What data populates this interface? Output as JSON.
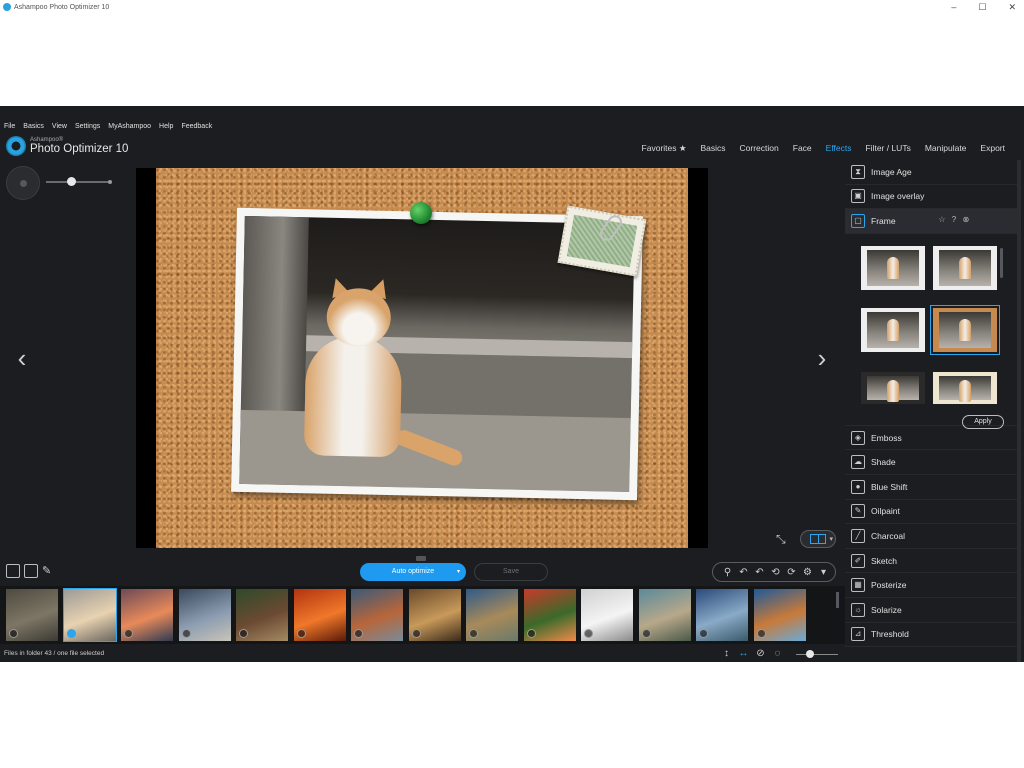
{
  "window": {
    "title": "Ashampoo Photo Optimizer 10",
    "controls": [
      "–",
      "☐",
      "✕"
    ]
  },
  "menu": [
    "File",
    "Basics",
    "View",
    "Settings",
    "MyAshampoo",
    "Help",
    "Feedback"
  ],
  "brand": {
    "company": "Ashampoo®",
    "product": "Photo Optimizer 10"
  },
  "tabs": [
    {
      "label": "Favorites ★",
      "active": false
    },
    {
      "label": "Basics",
      "active": false
    },
    {
      "label": "Correction",
      "active": false
    },
    {
      "label": "Face",
      "active": false
    },
    {
      "label": "Effects",
      "active": true
    },
    {
      "label": "Filter / LUTs",
      "active": false
    },
    {
      "label": "Manipulate",
      "active": false
    },
    {
      "label": "Export",
      "active": false
    }
  ],
  "nav": {
    "prev": "‹",
    "next": "›"
  },
  "effects_top": [
    {
      "label": "Image Age",
      "icon": "hourglass-icon",
      "glyph": "⧗"
    },
    {
      "label": "Image overlay",
      "icon": "image-overlay-icon",
      "glyph": "▣"
    },
    {
      "label": "Frame",
      "icon": "frame-icon",
      "glyph": "▢",
      "active": true
    }
  ],
  "frame_tools": [
    "☆",
    "?",
    "⊗"
  ],
  "apply_label": "Apply",
  "effects_bottom": [
    {
      "label": "Emboss",
      "icon": "emboss-icon",
      "glyph": "◈"
    },
    {
      "label": "Shade",
      "icon": "shade-icon",
      "glyph": "☁"
    },
    {
      "label": "Blue Shift",
      "icon": "blue-shift-icon",
      "glyph": "●"
    },
    {
      "label": "Oilpaint",
      "icon": "oilpaint-icon",
      "glyph": "✎"
    },
    {
      "label": "Charcoal",
      "icon": "charcoal-icon",
      "glyph": "╱"
    },
    {
      "label": "Sketch",
      "icon": "sketch-icon",
      "glyph": "✐"
    },
    {
      "label": "Posterize",
      "icon": "posterize-icon",
      "glyph": "▦"
    },
    {
      "label": "Solarize",
      "icon": "solarize-icon",
      "glyph": "☼"
    },
    {
      "label": "Threshold",
      "icon": "threshold-icon",
      "glyph": "⊿"
    }
  ],
  "actions": {
    "auto_optimize": "Auto optimize",
    "save": "Save"
  },
  "history_tools": [
    "⚲",
    "↶",
    "↶",
    "⟲",
    "⟳",
    "⚙",
    "▾"
  ],
  "filmstrip": [
    {
      "colors": [
        "#4e4a40",
        "#7d7665",
        "#3c3a34"
      ],
      "selected": false
    },
    {
      "colors": [
        "#9c9a96",
        "#e8d2b0",
        "#6a6660"
      ],
      "selected": true
    },
    {
      "colors": [
        "#6c4a58",
        "#e88a5a",
        "#2e3a52"
      ],
      "selected": false
    },
    {
      "colors": [
        "#3a4a5c",
        "#8a9bb0",
        "#c8c4b8"
      ],
      "selected": false
    },
    {
      "colors": [
        "#2f4a2a",
        "#6b4a32",
        "#a58a62"
      ],
      "selected": false
    },
    {
      "colors": [
        "#b23410",
        "#f0782a",
        "#5a1a08"
      ],
      "selected": false
    },
    {
      "colors": [
        "#3a5a7a",
        "#b8663a",
        "#7a8a9a"
      ],
      "selected": false
    },
    {
      "colors": [
        "#6a4a2a",
        "#c89a5a",
        "#3a2a1a"
      ],
      "selected": false
    },
    {
      "colors": [
        "#2f5a8a",
        "#a88a5a",
        "#6a7a6a"
      ],
      "selected": false
    },
    {
      "colors": [
        "#c83a2a",
        "#3a6a2a",
        "#f08a4a"
      ],
      "selected": false
    },
    {
      "colors": [
        "#d0d0d0",
        "#f4f4f4",
        "#8a8a8a"
      ],
      "selected": false
    },
    {
      "colors": [
        "#5a8a9a",
        "#b8a88a",
        "#4a5a4a"
      ],
      "selected": false
    },
    {
      "colors": [
        "#2a4a7a",
        "#8aaac8",
        "#3a5a6a"
      ],
      "selected": false
    },
    {
      "colors": [
        "#1e5a9a",
        "#c87a3a",
        "#6aaad8"
      ],
      "selected": false
    }
  ],
  "status": {
    "text": "Files in folder 43 / one file selected",
    "icons": [
      "↕",
      "↔",
      "⊘",
      "◌"
    ]
  },
  "colors": {
    "accent": "#2aa6ef",
    "button_blue": "#1e9bf0",
    "background": "#1c1d20"
  }
}
